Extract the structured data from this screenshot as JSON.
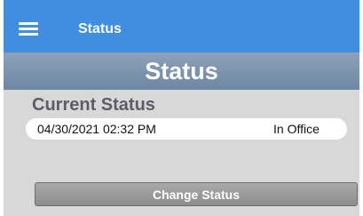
{
  "appbar": {
    "title": "Status",
    "menu_icon": "hamburger-menu-icon"
  },
  "page": {
    "title": "Status"
  },
  "current_status": {
    "heading": "Current Status",
    "timestamp": "04/30/2021 02:32 PM",
    "value": "In Office"
  },
  "actions": {
    "change_status_label": "Change Status"
  },
  "colors": {
    "appbar": "#3f8ee0",
    "header": "#7b93ac",
    "background": "#d8d8d8",
    "button": "#9b9b9b"
  }
}
